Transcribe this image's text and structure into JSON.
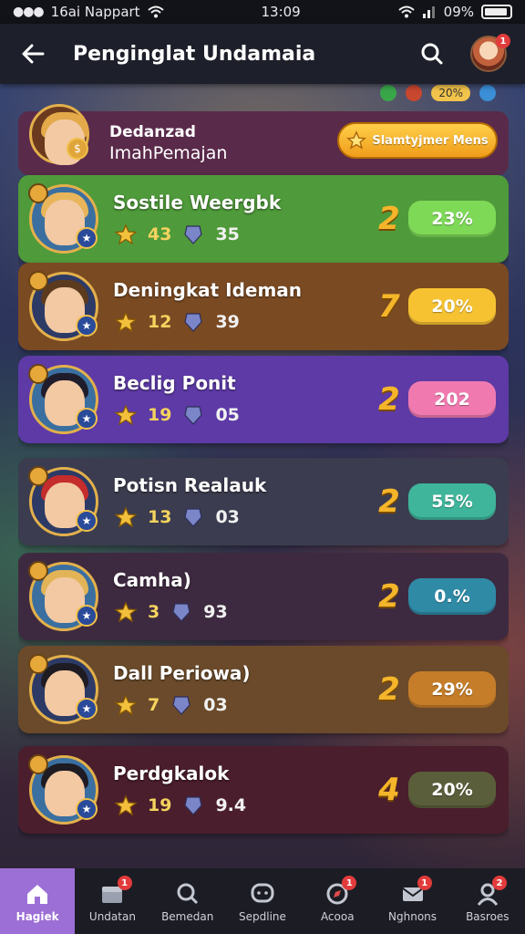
{
  "status_bar": {
    "carrier": "16ai Nappart",
    "time": "13:09",
    "battery": "09%"
  },
  "app_bar": {
    "title": "Penginglat Undamaia",
    "notif_count": "1"
  },
  "top_partial": {
    "chip": "20%"
  },
  "invite_row": {
    "line1": "Dedanzad",
    "line2": "ImahPemajan",
    "button_label": "Slamtyjmer Mens"
  },
  "rows": [
    {
      "name": "Sostile Weergbk",
      "stat1": "43",
      "stat2": "35",
      "rank": "2",
      "percent": "23%",
      "bg": "#4f9a3a",
      "pill": "#7ed957",
      "hair": "#e8b55a"
    },
    {
      "name": "Deningkat Ideman",
      "stat1": "12",
      "stat2": "39",
      "rank": "7",
      "percent": "20%",
      "bg": "#7a4a22",
      "pill": "#f6c232",
      "hair": "#5c3a1e"
    },
    {
      "name": "Beclig Ponit",
      "stat1": "19",
      "stat2": "05",
      "rank": "2",
      "percent": "202",
      "bg": "#5d3aa6",
      "pill": "#f07ab0",
      "hair": "#1f1c2b"
    },
    {
      "name": "Potisn Realauk",
      "stat1": "13",
      "stat2": "03",
      "rank": "2",
      "percent": "55%",
      "bg": "#3b3c4f",
      "pill": "#3fb59b",
      "hair": "#c52c2c"
    },
    {
      "name": "Camha)",
      "stat1": "3",
      "stat2": "93",
      "rank": "2",
      "percent": "0.%",
      "bg": "#3e2a40",
      "pill": "#2f8aa6",
      "hair": "#e2b457"
    },
    {
      "name": "Dall Periowa)",
      "stat1": "7",
      "stat2": "03",
      "rank": "2",
      "percent": "29%",
      "bg": "#6a4a2a",
      "pill": "#c57d2a",
      "hair": "#1e1b22"
    },
    {
      "name": "Perdgkalok",
      "stat1": "19",
      "stat2": "9.4",
      "rank": "4",
      "percent": "20%",
      "bg": "#4a1e2c",
      "pill": "#5b5e3a",
      "hair": "#1e1b22"
    }
  ],
  "tabs": [
    {
      "label": "Hagiek",
      "icon": "home-icon",
      "badge": ""
    },
    {
      "label": "Undatan",
      "icon": "chest-icon",
      "badge": "1"
    },
    {
      "label": "Bemedan",
      "icon": "search-icon",
      "badge": ""
    },
    {
      "label": "Sepdline",
      "icon": "chat-icon",
      "badge": ""
    },
    {
      "label": "Acooa",
      "icon": "compass-icon",
      "badge": "1"
    },
    {
      "label": "Nghnons",
      "icon": "mail-icon",
      "badge": "1"
    },
    {
      "label": "Basroes",
      "icon": "profile-icon",
      "badge": "2"
    }
  ]
}
